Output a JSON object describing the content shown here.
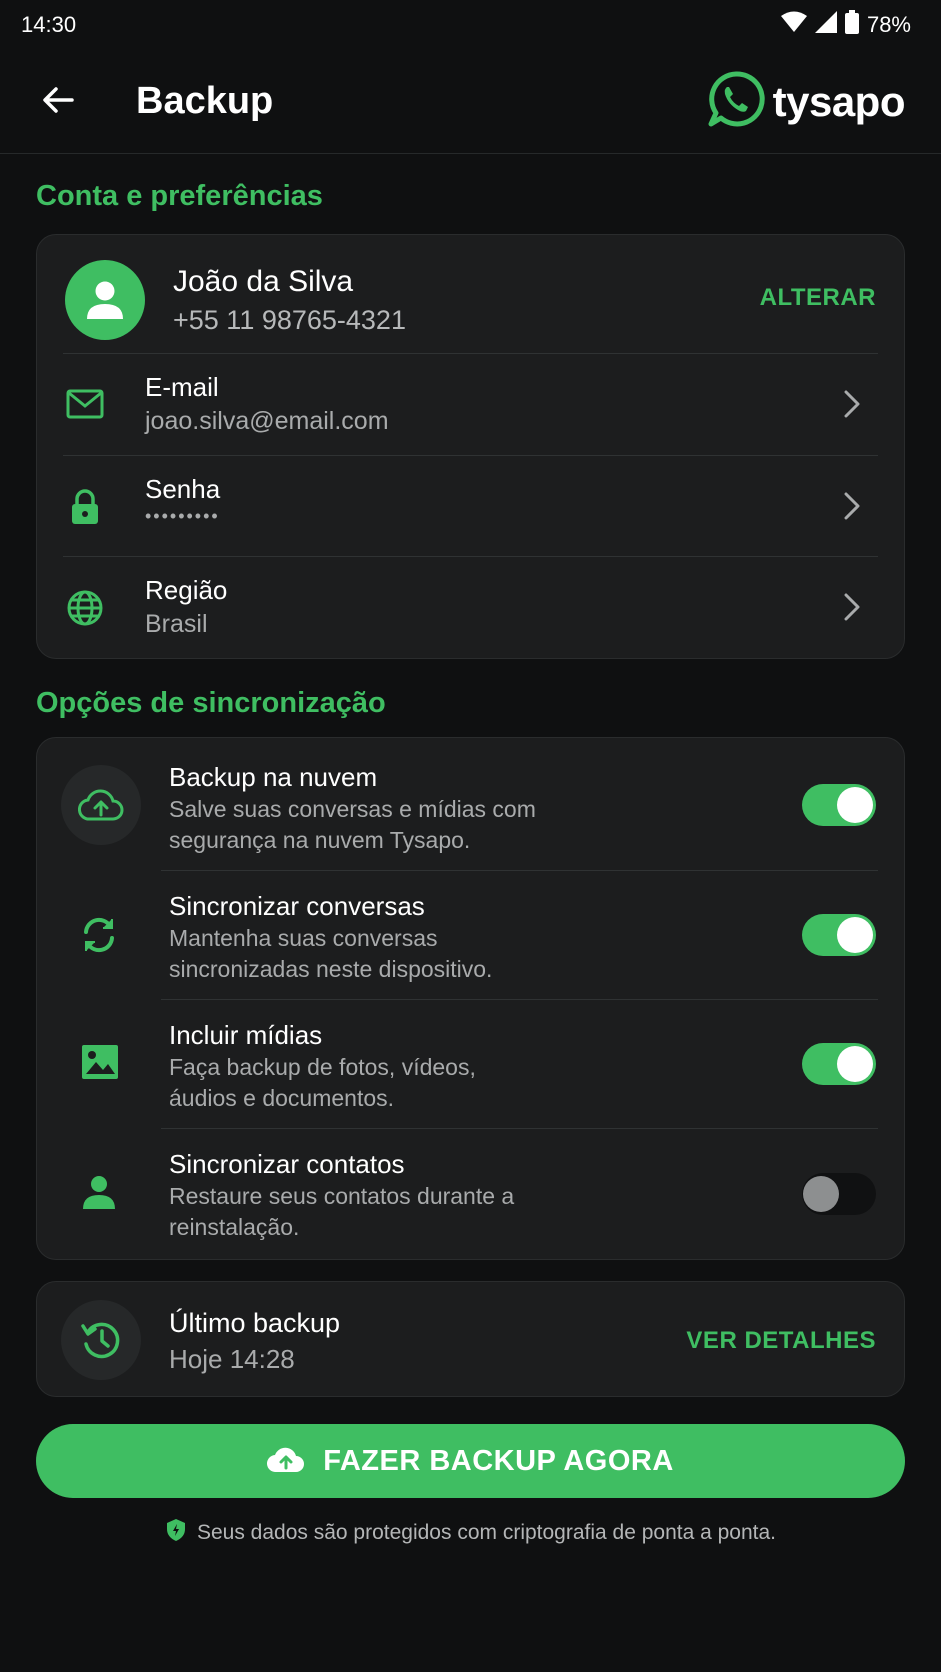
{
  "status_bar": {
    "time": "14:30",
    "battery": "78%"
  },
  "app_bar": {
    "title": "Backup",
    "brand": "tysapo"
  },
  "colors": {
    "accent": "#3fbe62",
    "background": "#0f1011",
    "card": "#1c1d1e"
  },
  "account": {
    "section_title": "Conta e preferências",
    "name": "João da Silva",
    "phone": "+55 11 98765-4321",
    "change_label": "ALTERAR",
    "rows": [
      {
        "icon": "mail-icon",
        "label": "E-mail",
        "value": "joao.silva@email.com"
      },
      {
        "icon": "lock-icon",
        "label": "Senha",
        "value": "•••••••••"
      },
      {
        "icon": "globe-icon",
        "label": "Região",
        "value": "Brasil"
      }
    ]
  },
  "sync": {
    "section_title": "Opções de sincronização",
    "items": [
      {
        "icon": "cloud-upload-icon",
        "title": "Backup na nuvem",
        "desc1": "Salve suas conversas e mídias com",
        "desc2": "segurança na nuvem Tysapo.",
        "enabled": true
      },
      {
        "icon": "sync-icon",
        "title": "Sincronizar conversas",
        "desc1": "Mantenha suas conversas",
        "desc2": "sincronizadas neste dispositivo.",
        "enabled": true
      },
      {
        "icon": "image-icon",
        "title": "Incluir mídias",
        "desc1": "Faça backup de fotos, vídeos,",
        "desc2": "áudios e documentos.",
        "enabled": true
      },
      {
        "icon": "person-icon",
        "title": "Sincronizar contatos",
        "desc1": "Restaure seus contatos durante a",
        "desc2": "reinstalação.",
        "enabled": false
      }
    ]
  },
  "last_backup": {
    "title": "Último backup",
    "value": "Hoje 14:28",
    "details_label": "VER DETALHES"
  },
  "cta": {
    "label": "FAZER BACKUP AGORA"
  },
  "footer": {
    "text": "Seus dados são protegidos com criptografia de ponta a ponta."
  }
}
